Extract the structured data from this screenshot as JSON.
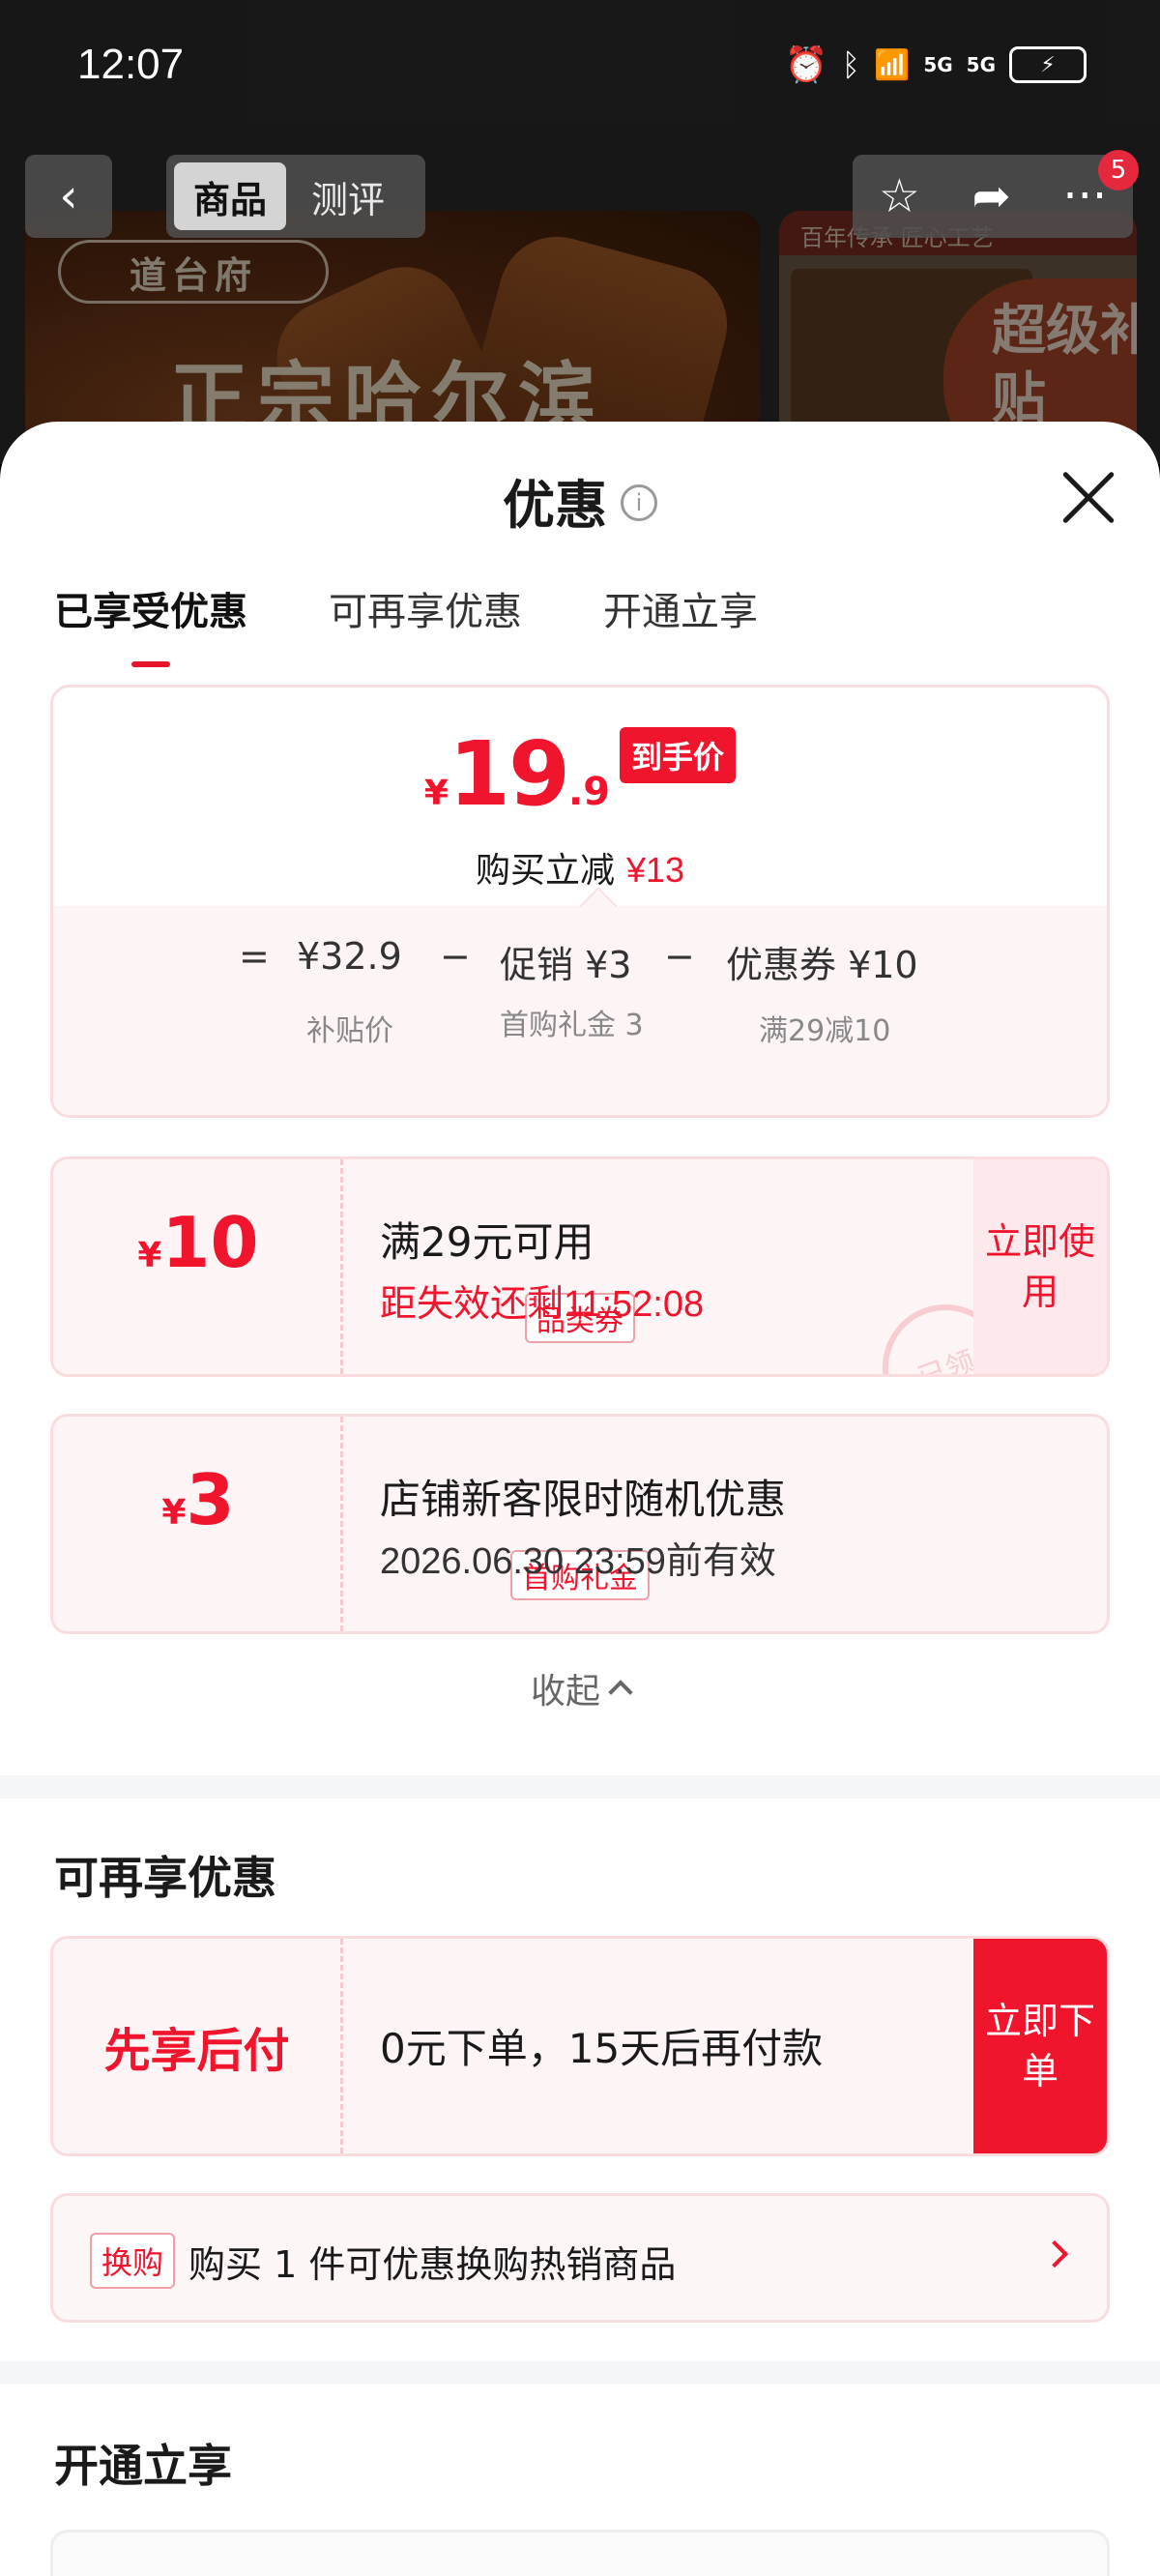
{
  "status_bar": {
    "time": "12:07",
    "net1": "5G",
    "net2": "5G"
  },
  "background": {
    "tabs": [
      "商品",
      "测评"
    ],
    "brand": "道台府",
    "headline": "正宗哈尔滨",
    "right_top": "百年传承 匠心工艺",
    "promo": "超级补贴",
    "notify_count": "5"
  },
  "sheet": {
    "title": "优惠",
    "tabs": [
      "已享受优惠",
      "可再享优惠",
      "开通立享"
    ],
    "summary": {
      "yen": "¥",
      "price_int": "19",
      "price_dec": ".9",
      "price_tag": "到手价",
      "cut_label": "购买立减",
      "cut_amount": "¥13",
      "eq": "=",
      "minus": "−",
      "subsidy_value": "¥32.9",
      "subsidy_label": "补贴价",
      "promo_value": "促销 ¥3",
      "promo_label": "首购礼金 3",
      "coupon_value": "优惠券 ¥10",
      "coupon_label": "满29减10"
    },
    "coupons": [
      {
        "yen": "¥",
        "amount": "10",
        "tag": "品类券",
        "title": "满29元可用",
        "subtitle": "距失效还剩11:52:08",
        "action": "立即使用",
        "stamp": "已领"
      },
      {
        "yen": "¥",
        "amount": "3",
        "tag": "首购礼金",
        "title": "店铺新客限时随机优惠",
        "subtitle": "2026.06.30 23:59前有效"
      }
    ],
    "collapse": "收起",
    "more_section": {
      "title": "可再享优惠",
      "pay_later": {
        "label": "先享后付",
        "text": "0元下单，15天后再付款",
        "action": "立即下单"
      },
      "swap": {
        "tag": "换购",
        "text": "购买 1 件可优惠换购热销商品"
      }
    },
    "open_section": {
      "title": "开通立享"
    }
  },
  "colors": {
    "accent": "#f0142d",
    "card_bg": "#fdf4f5",
    "border": "#fadcde"
  }
}
